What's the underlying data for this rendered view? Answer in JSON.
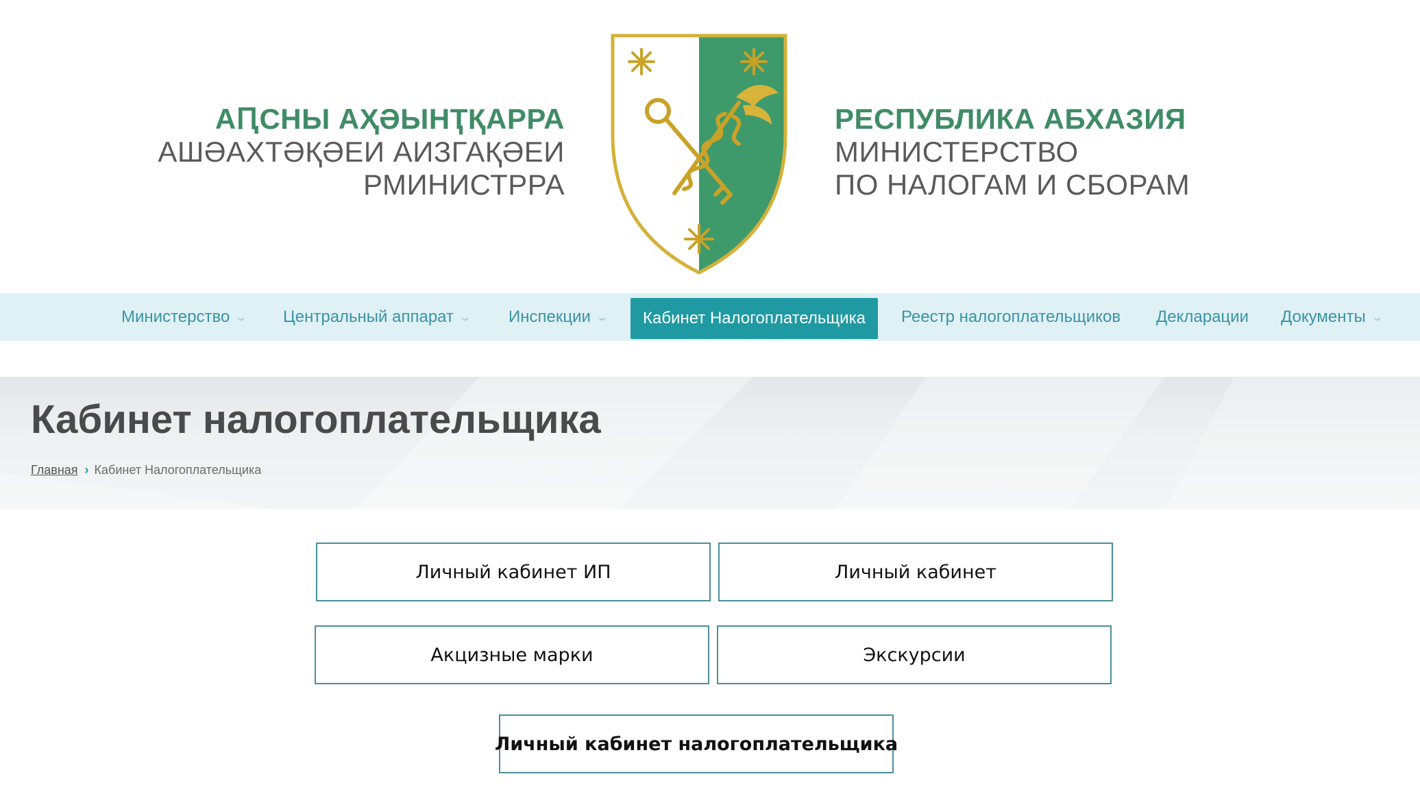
{
  "header": {
    "left_lines": [
      "АԤСНЫ АҲӘЫНҬҚАРРА",
      "АШӘАХТӘҚӘЕИ АИЗГАҚӘЕИ",
      "РМИНИСТРРА"
    ],
    "right_lines": [
      "РЕСПУБЛИКА АБХАЗИЯ",
      "МИНИСТЕРСТВО",
      "ПО НАЛОГАМ И СБОРАМ"
    ]
  },
  "nav": {
    "items": [
      {
        "label": "Министерство",
        "has_dropdown": true
      },
      {
        "label": "Центральный аппарат",
        "has_dropdown": true
      },
      {
        "label": "Инспекции",
        "has_dropdown": true
      },
      {
        "label": "Кабинет Налогоплательщика",
        "active": true
      },
      {
        "label": "Реестр налогоплательщиков"
      },
      {
        "label": "Декларации"
      },
      {
        "label": "Документы",
        "has_dropdown": true
      }
    ],
    "chevron": "⌄"
  },
  "page": {
    "title": "Кабинет налогоплательщика",
    "breadcrumb": {
      "home": "Главная",
      "separator": "›",
      "current": "Кабинет Налогоплательщика"
    }
  },
  "buttons": {
    "ip_cabinet": "Личный кабинет ИП",
    "cabinet": "Личный кабинет",
    "excise": "Акцизные марки",
    "excursions": "Экскурсии",
    "taxpayer_cabinet": "Личный кабинет налогоплательщика"
  },
  "colors": {
    "brand_green": "#3f8c66",
    "emblem_green": "#3f9a6b",
    "emblem_gold": "#d4b13a",
    "nav_bg": "#dff1f4",
    "nav_text": "#3a93a6",
    "nav_active_bg": "#1f9aa3",
    "button_border": "#4a8e98"
  }
}
